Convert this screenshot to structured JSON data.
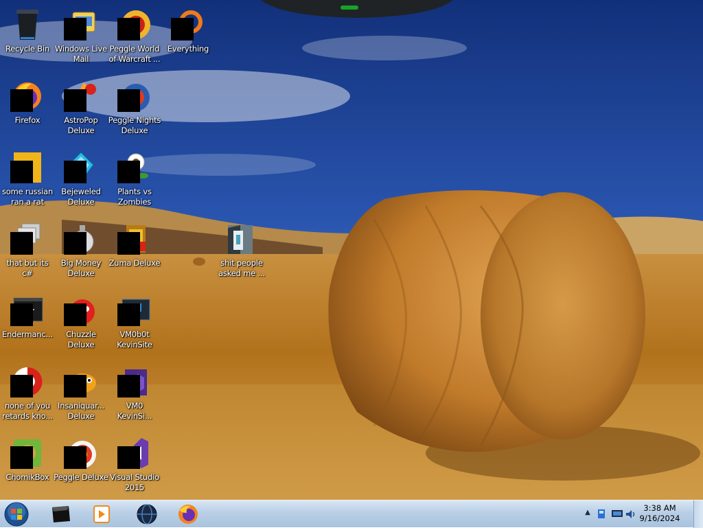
{
  "desktop": {
    "icons": [
      {
        "label": "Recycle Bin",
        "icon": "recycle-bin-icon",
        "redacted": false
      },
      {
        "label": "Firefox",
        "icon": "firefox-icon",
        "redacted": true
      },
      {
        "label": "some russian\nran a rat",
        "icon": "java-file-icon",
        "redacted": true
      },
      {
        "label": "that but its c#",
        "icon": "stacked-windows-icon",
        "redacted": true
      },
      {
        "label": "Endermanc...",
        "icon": "terminal-window-icon",
        "redacted": true
      },
      {
        "label": "none of you\nretards kno...",
        "icon": "red-circle-app-icon",
        "redacted": true
      },
      {
        "label": "ChomikBox",
        "icon": "hamster-box-icon",
        "redacted": true
      },
      {
        "label": "Windows Live\nMail",
        "icon": "mail-icon",
        "redacted": true
      },
      {
        "label": "AstroPop\nDeluxe",
        "icon": "astropop-icon",
        "redacted": true
      },
      {
        "label": "Bejeweled\nDeluxe",
        "icon": "bejeweled-icon",
        "redacted": true
      },
      {
        "label": "Big Money\nDeluxe",
        "icon": "big-money-icon",
        "redacted": true
      },
      {
        "label": "Chuzzle\nDeluxe",
        "icon": "chuzzle-icon",
        "redacted": true
      },
      {
        "label": "Insaniquar...\nDeluxe",
        "icon": "insaniquarium-icon",
        "redacted": true
      },
      {
        "label": "Peggle Deluxe",
        "icon": "peggle-icon",
        "redacted": true
      },
      {
        "label": "Peggle World\nof Warcraft ...",
        "icon": "peggle-wow-icon",
        "redacted": true
      },
      {
        "label": "Peggle Nights\nDeluxe",
        "icon": "peggle-nights-icon",
        "redacted": true
      },
      {
        "label": "Plants vs\nZombies",
        "icon": "plants-vs-zombies-icon",
        "redacted": true
      },
      {
        "label": "Zuma Deluxe",
        "icon": "zuma-icon",
        "redacted": true
      },
      {
        "label": "VM0b0t\nKevinSite",
        "icon": "terminal-app-icon",
        "redacted": true
      },
      {
        "label": "VM0\nKevinSi...",
        "icon": "visual-studio-purple-icon",
        "redacted": true
      },
      {
        "label": "Visual Studio\n2015",
        "icon": "visual-studio-icon",
        "redacted": true
      },
      {
        "label": "Everything",
        "icon": "everything-search-icon",
        "redacted": true
      },
      {
        "label": "shit people\nasked me ...",
        "icon": "folder-icon",
        "redacted": false
      }
    ]
  },
  "taskbar": {
    "start": {
      "icon": "windows-start-orb-icon"
    },
    "pinned": [
      {
        "name": "dark-app-icon"
      },
      {
        "name": "media-player-icon"
      },
      {
        "name": "globe-app-icon"
      },
      {
        "name": "firefox-icon"
      }
    ],
    "tray": {
      "overflow_glyph": "▲",
      "icons": [
        "network-status-icon",
        "monitor-icon",
        "volume-icon"
      ],
      "time": "3:38 AM",
      "date": "9/16/2024"
    }
  }
}
